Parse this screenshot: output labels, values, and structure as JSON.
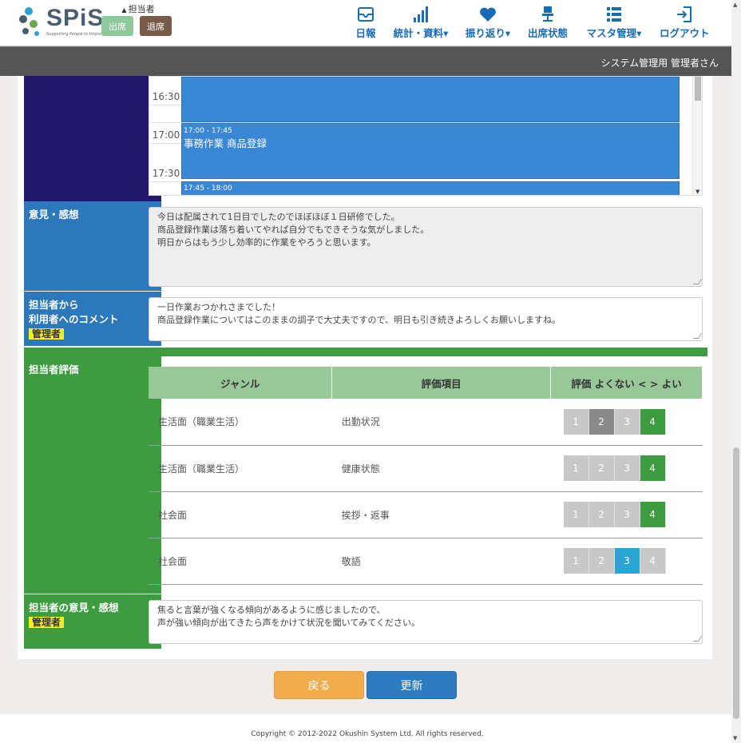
{
  "header": {
    "logo": "SPiS",
    "logo_tagline": "Supporting People to Improve Stability",
    "role_label": "担当者",
    "attend_button": "出席",
    "leave_button": "退席",
    "nav": [
      {
        "label": "日報",
        "icon": "inbox-icon"
      },
      {
        "label": "統計・資料",
        "icon": "bar-chart-icon",
        "dropdown": true
      },
      {
        "label": "振り返り",
        "icon": "heart-icon",
        "dropdown": true
      },
      {
        "label": "出席状態",
        "icon": "chair-icon"
      },
      {
        "label": "マスタ管理",
        "icon": "list-icon",
        "dropdown": true
      },
      {
        "label": "ログアウト",
        "icon": "logout-icon"
      }
    ],
    "user_name": "システム管理用 管理者さん"
  },
  "schedule": {
    "times": [
      "16:30",
      "17:00",
      "17:30"
    ],
    "events": [
      {
        "time": "17:00 - 17:45",
        "title": "事務作業 商品登録"
      },
      {
        "time": "17:45 - 18:00",
        "title": ""
      }
    ]
  },
  "impressions": {
    "label": "意見・感想",
    "text": "今日は配属されて1日目でしたのでほぼほぼ１日研修でした。\n商品登録作業は落ち着いてやれば自分でもできそうな気がしました。\n明日からはもう少し効率的に作業をやろうと思います。"
  },
  "staff_comment": {
    "label_line1": "担当者から",
    "label_line2": "利用者へのコメント",
    "badge": "管理者",
    "text": "一日作業おつかれさまでした！\n商品登録作業についてはこのままの調子で大丈夫ですので、明日も引き続きよろしくお願いしますね。"
  },
  "evaluation": {
    "label": "担当者評価",
    "headers": [
      "ジャンル",
      "評価項目",
      "評価 よくない < > よい"
    ],
    "rows": [
      {
        "genre": "生活面（職業生活）",
        "item": "出勤状況",
        "score": 4
      },
      {
        "genre": "生活面（職業生活）",
        "item": "健康状態",
        "score": 4
      },
      {
        "genre": "社会面",
        "item": "挨拶・返事",
        "score": 4
      },
      {
        "genre": "社会面",
        "item": "敬語",
        "score": 3
      }
    ]
  },
  "staff_opinion": {
    "label": "担当者の意見・感想",
    "badge": "管理者",
    "text": "焦ると言葉が強くなる傾向があるように感じましたので、\n声が強い傾向が出てきたら声をかけて状況を聞いてみてください。"
  },
  "buttons": {
    "back": "戻る",
    "update": "更新"
  },
  "footer": {
    "copyright": "Copyright © 2012-2022 Okushin System Ltd. All rights reserved."
  },
  "colors": {
    "nav_text": "#1a6bb5",
    "schedule_label": "#23186b",
    "blue_label": "#2c78bb",
    "green_label": "#3d9c40",
    "event": "#3a87d6",
    "admin_badge": "#f7ef1f"
  }
}
